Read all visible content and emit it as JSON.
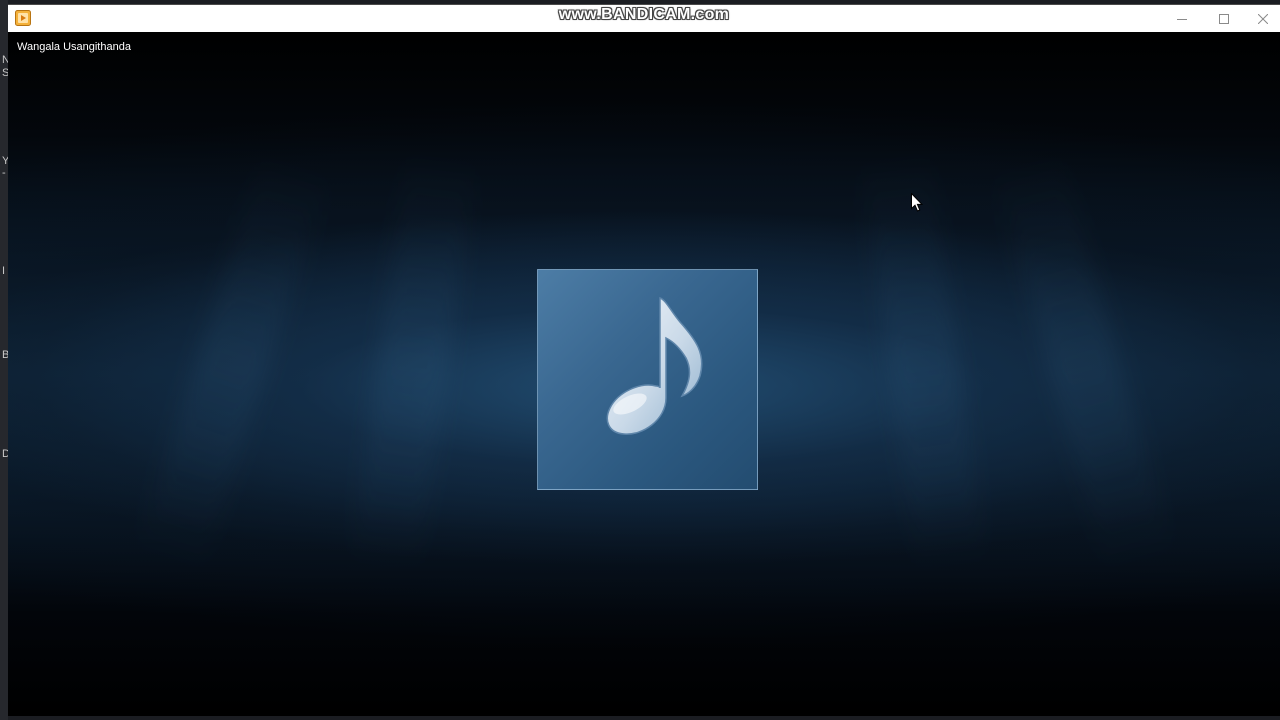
{
  "recorder": {
    "watermark": "www.BANDICAM.com"
  },
  "window": {
    "app_icon": "media-player-icon",
    "controls": {
      "minimize": "minimize-icon",
      "maximize": "maximize-icon",
      "close": "close-icon"
    }
  },
  "player": {
    "track_title": "Wangala Usangithanda",
    "album_art_icon": "music-note-icon"
  },
  "desktop_edge": {
    "glyphs": [
      "N",
      "S",
      "Y",
      "-",
      "I",
      "B",
      "D"
    ]
  },
  "colors": {
    "titlebar": "#ffffff",
    "background": "#000000",
    "accent_blue": "#3a6891",
    "app_icon_orange": "#f0a020"
  }
}
